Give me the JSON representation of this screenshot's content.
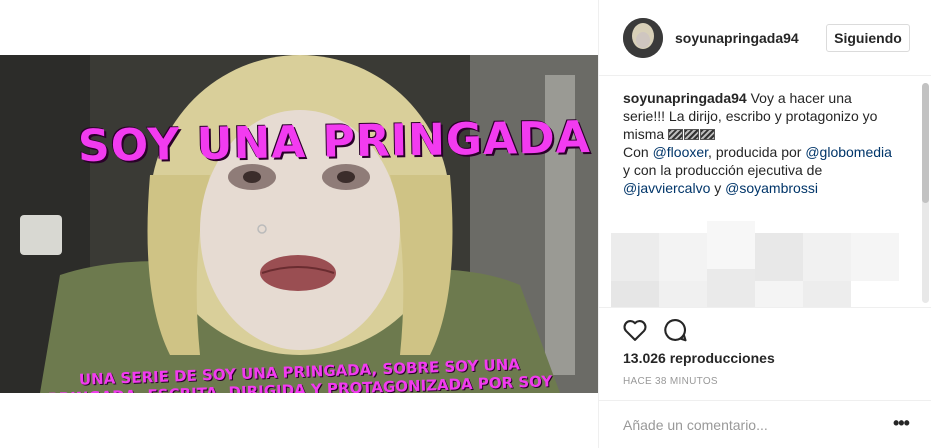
{
  "post": {
    "username": "soyunapringada94",
    "follow_label": "Siguiendo"
  },
  "video": {
    "title_overlay": "SOY UNA PRINGADA",
    "subtitle_overlay": "UNA SERIE DE SOY UNA PRINGADA, SOBRE SOY UNA PRINGADA, ESCRITA, DIRIGIDA Y PROTAGONIZADA POR SOY UNA PRINGADA"
  },
  "caption": {
    "user": "soyunapringada94",
    "text_1": " Voy a hacer una serie!!! La dirijo, escribo y protagonizo yo misma ",
    "clapper_icons": "🎬🎬🎬",
    "text_2": "Con ",
    "mention_1": "@flooxer",
    "text_3": ", producida por ",
    "mention_2": "@globomedia",
    "text_4": " y con la producción ejecutiva de ",
    "mention_3": "@javviercalvo",
    "text_5": " y ",
    "mention_4": "@soyambrossi"
  },
  "stats": {
    "views": "13.026 reproducciones",
    "time": "HACE 38 MINUTOS"
  },
  "comment_box": {
    "placeholder": "Añade un comentario...",
    "more_label": "•••"
  },
  "icons": {
    "like": "heart-icon",
    "comment": "comment-bubble-icon",
    "more": "more-options-icon"
  },
  "colors": {
    "overlay_text": "#f23bf0",
    "link": "#003569",
    "muted": "#999999"
  }
}
